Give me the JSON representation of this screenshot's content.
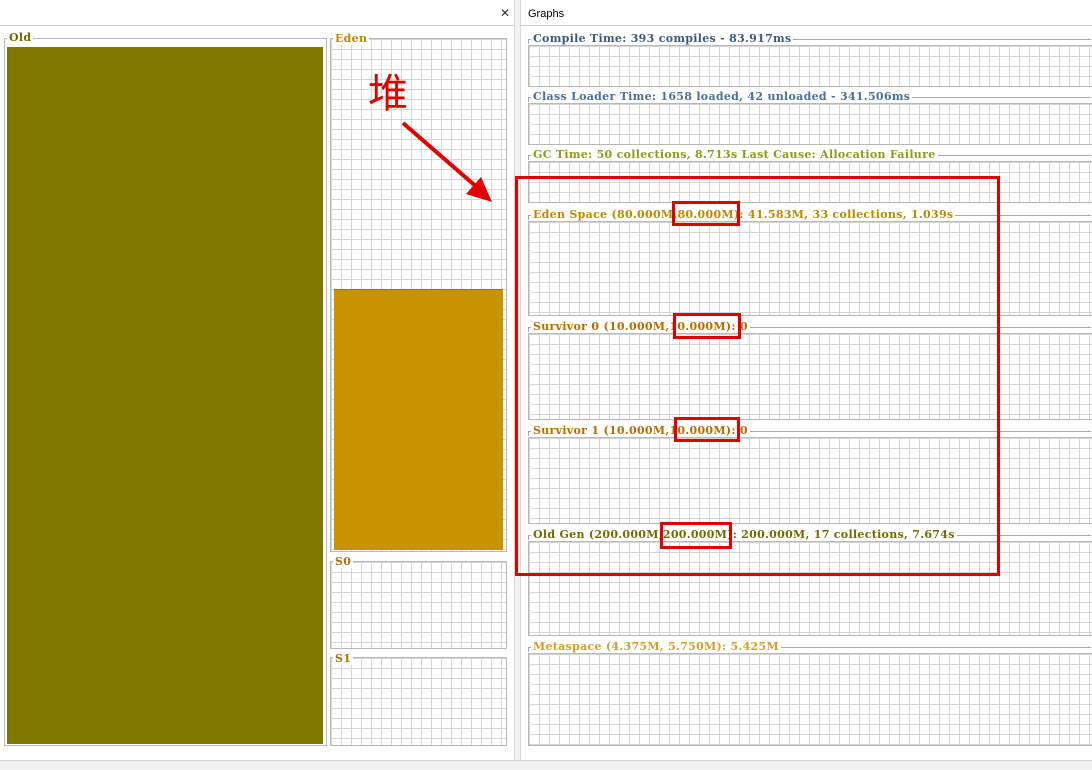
{
  "left_panel": {
    "close_icon": "✕",
    "spaces": [
      {
        "label": "Old",
        "color": "#6f6b00",
        "fill_fraction": 1.0
      },
      {
        "label": "Eden",
        "color": "#b88a00",
        "fill_fraction": 0.52
      },
      {
        "label": "S0",
        "color": "#b86c00",
        "fill_fraction": 0.0
      },
      {
        "label": "S1",
        "color": "#b86c00",
        "fill_fraction": 0.0
      }
    ],
    "old_fill_color": "#807700",
    "eden_fill_color": "#c99200"
  },
  "annotation": {
    "heap_label": "堆",
    "color": "#e00000"
  },
  "graphs_panel": {
    "tab": "Graphs",
    "graphs": [
      {
        "title": "Compile Time: 393 compiles - 83.917ms",
        "color": "#3c5a78"
      },
      {
        "title": "Class Loader Time: 1658 loaded, 42 unloaded - 341.506ms",
        "color": "#4a7096"
      },
      {
        "title": "GC Time: 50 collections, 8.713s  Last Cause: Allocation Failure",
        "color": "#8c9a1e"
      },
      {
        "title": "Eden Space (80.000M,80.000M): 41.583M, 33 collections, 1.039s",
        "color": "#b88a00"
      },
      {
        "title": "Survivor 0 (10.000M,10.000M): 0",
        "color": "#b86c00"
      },
      {
        "title": "Survivor 1 (10.000M,10.000M): 0",
        "color": "#b86c00"
      },
      {
        "title": "Old Gen (200.000M,200.000M): 200.000M, 17 collections, 7.674s",
        "color": "#6f6b00"
      },
      {
        "title": "Metaspace (4.375M, 5.750M): 5.425M",
        "color": "#d0a028"
      }
    ]
  }
}
